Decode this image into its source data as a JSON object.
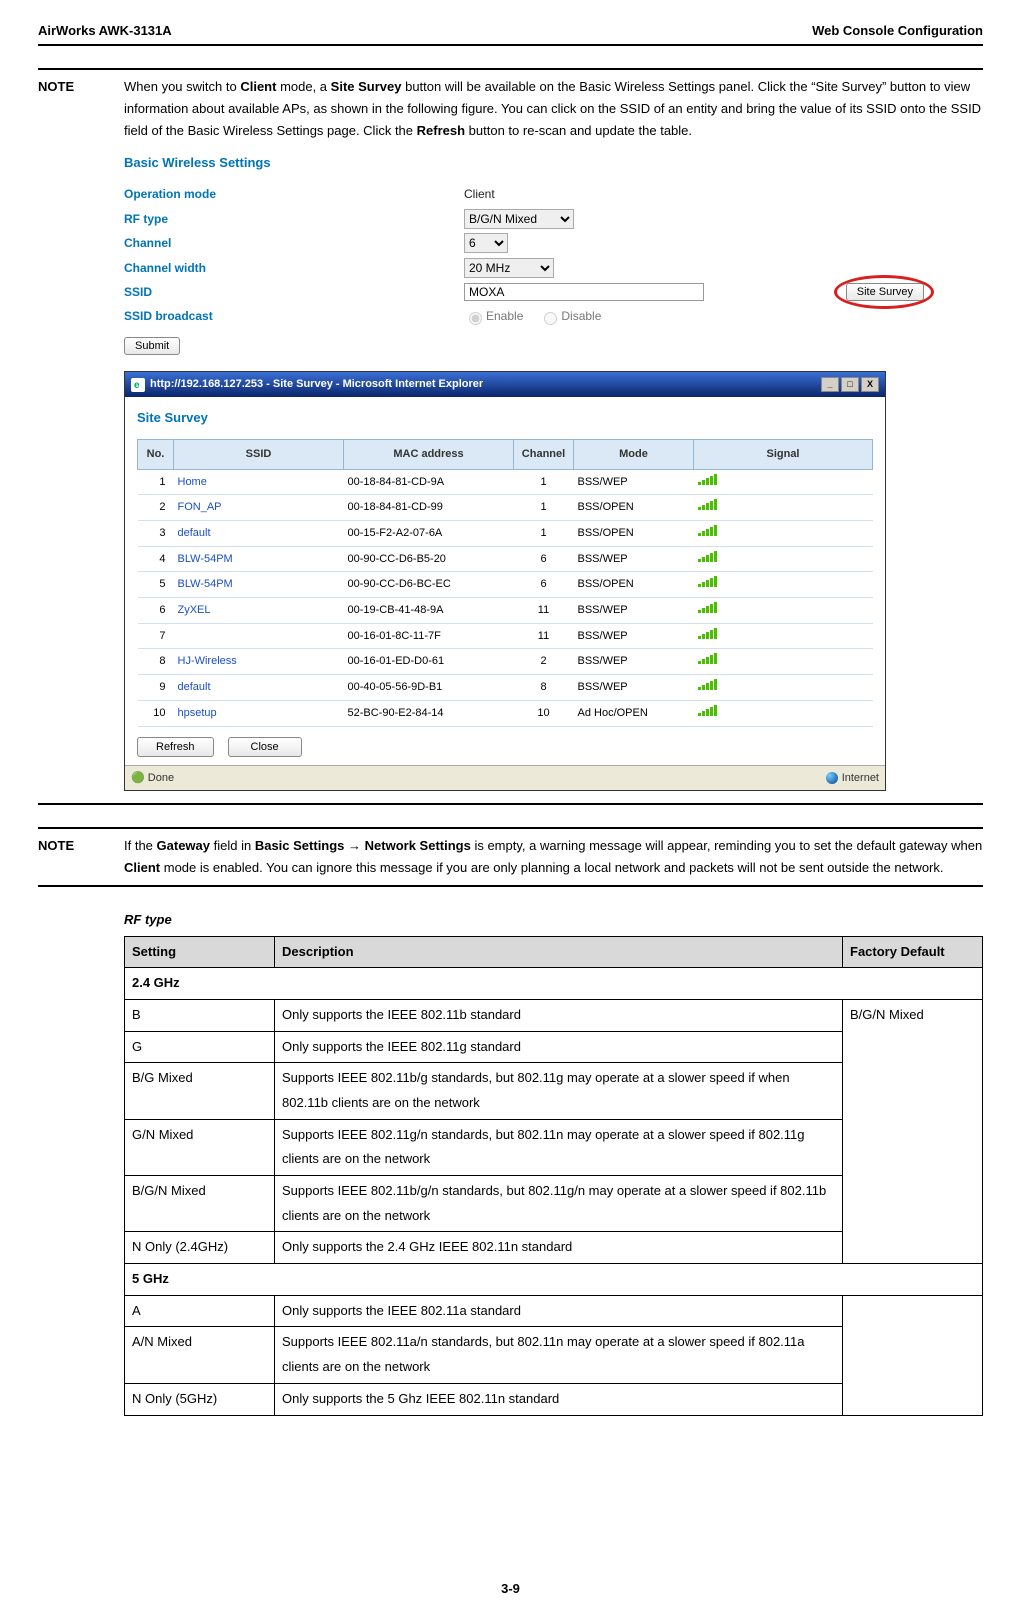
{
  "header": {
    "left": "AirWorks AWK-3131A",
    "right": "Web Console Configuration"
  },
  "note1": {
    "label": "NOTE",
    "text_a": "When you switch to ",
    "bold1": "Client",
    "text_b": " mode, a ",
    "bold2": "Site Survey",
    "text_c": " button will be available on the Basic Wireless Settings panel. Click the “Site Survey” button to view information about available APs, as shown in the following figure. You can click on the SSID of an entity and bring the value of its SSID onto the SSID field of the Basic Wireless Settings page. Click the ",
    "bold3": "Refresh",
    "text_d": " button to re-scan and update the table."
  },
  "bws": {
    "title": "Basic Wireless Settings",
    "labels": {
      "op_mode": "Operation mode",
      "rf_type": "RF type",
      "channel": "Channel",
      "channel_width": "Channel width",
      "ssid": "SSID",
      "ssid_broadcast": "SSID broadcast"
    },
    "values": {
      "op_mode": "Client",
      "rf_type": "B/G/N Mixed",
      "channel": "6",
      "channel_width": "20 MHz",
      "ssid": "MOXA",
      "enable": "Enable",
      "disable": "Disable"
    },
    "site_survey_btn": "Site Survey",
    "submit": "Submit"
  },
  "ie": {
    "title": "http://192.168.127.253 - Site Survey - Microsoft Internet Explorer",
    "min": "_",
    "max": "□",
    "close": "X",
    "ss_title": "Site Survey",
    "headers": {
      "no": "No.",
      "ssid": "SSID",
      "mac": "MAC address",
      "channel": "Channel",
      "mode": "Mode",
      "signal": "Signal"
    },
    "rows": [
      {
        "no": "1",
        "ssid": "Home",
        "mac": "00-18-84-81-CD-9A",
        "channel": "1",
        "mode": "BSS/WEP"
      },
      {
        "no": "2",
        "ssid": "FON_AP",
        "mac": "00-18-84-81-CD-99",
        "channel": "1",
        "mode": "BSS/OPEN"
      },
      {
        "no": "3",
        "ssid": "default",
        "mac": "00-15-F2-A2-07-6A",
        "channel": "1",
        "mode": "BSS/OPEN"
      },
      {
        "no": "4",
        "ssid": "BLW-54PM",
        "mac": "00-90-CC-D6-B5-20",
        "channel": "6",
        "mode": "BSS/WEP"
      },
      {
        "no": "5",
        "ssid": "BLW-54PM",
        "mac": "00-90-CC-D6-BC-EC",
        "channel": "6",
        "mode": "BSS/OPEN"
      },
      {
        "no": "6",
        "ssid": "ZyXEL",
        "mac": "00-19-CB-41-48-9A",
        "channel": "11",
        "mode": "BSS/WEP"
      },
      {
        "no": "7",
        "ssid": "",
        "mac": "00-16-01-8C-11-7F",
        "channel": "11",
        "mode": "BSS/WEP"
      },
      {
        "no": "8",
        "ssid": "HJ-Wireless",
        "mac": "00-16-01-ED-D0-61",
        "channel": "2",
        "mode": "BSS/WEP"
      },
      {
        "no": "9",
        "ssid": "default",
        "mac": "00-40-05-56-9D-B1",
        "channel": "8",
        "mode": "BSS/WEP"
      },
      {
        "no": "10",
        "ssid": "hpsetup",
        "mac": "52-BC-90-E2-84-14",
        "channel": "10",
        "mode": "Ad Hoc/OPEN"
      }
    ],
    "refresh": "Refresh",
    "close_btn": "Close",
    "status_left": "Done",
    "status_right": "Internet"
  },
  "note2": {
    "label": "NOTE",
    "text_a": "If the ",
    "bold1": "Gateway",
    "text_b": " field in ",
    "bold2": "Basic Settings",
    "arrow": " → ",
    "bold3": "Network Settings",
    "text_c": " is empty, a warning message will appear, reminding you to set the default gateway when ",
    "bold4": "Client",
    "text_d": " mode is enabled. You can ignore this message if you are only planning a local network and packets will not be sent outside the network."
  },
  "rf": {
    "title": "RF type",
    "headers": {
      "setting": "Setting",
      "desc": "Description",
      "default": "Factory Default"
    },
    "sec24": "2.4 GHz",
    "default24": "B/G/N Mixed",
    "rows24": [
      {
        "s": "B",
        "d": "Only supports the IEEE 802.11b standard"
      },
      {
        "s": "G",
        "d": "Only supports the IEEE 802.11g standard"
      },
      {
        "s": "B/G Mixed",
        "d": "Supports IEEE 802.11b/g standards, but 802.11g may operate at a slower speed if when 802.11b clients are on the network"
      },
      {
        "s": "G/N Mixed",
        "d": "Supports IEEE 802.11g/n standards, but 802.11n may operate at a slower speed if 802.11g clients are on the network"
      },
      {
        "s": "B/G/N Mixed",
        "d": "Supports IEEE 802.11b/g/n standards, but 802.11g/n may operate at a slower speed if 802.11b clients are on the network"
      },
      {
        "s": "N Only (2.4GHz)",
        "d": "Only supports the 2.4 GHz IEEE 802.11n standard"
      }
    ],
    "sec5": "5 GHz",
    "default5": "",
    "rows5": [
      {
        "s": "A",
        "d": "Only supports the IEEE 802.11a standard"
      },
      {
        "s": "A/N Mixed",
        "d": "Supports IEEE 802.11a/n standards, but 802.11n may operate at a slower speed if 802.11a clients are on the network"
      },
      {
        "s": "N Only (5GHz)",
        "d": "Only supports the 5 Ghz IEEE 802.11n standard"
      }
    ]
  },
  "page_num": "3-9"
}
